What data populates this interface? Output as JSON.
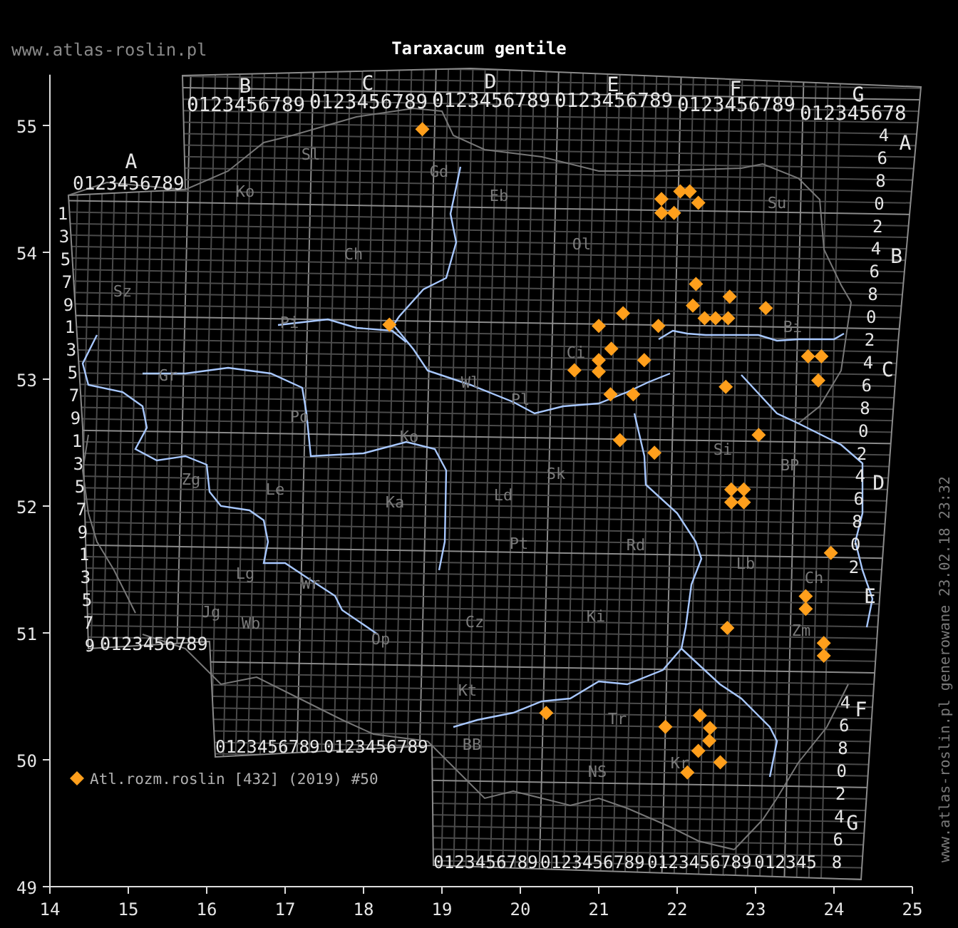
{
  "site": "www.atlas-roslin.pl",
  "title": "Taraxacum gentile",
  "stamp": "www.atlas-roslin.pl generowane 23.02.18 23:32",
  "grid": {
    "top_letters": [
      "B",
      "C",
      "D",
      "E",
      "F",
      "G"
    ],
    "top_digits": [
      "0123456789",
      "0123456789",
      "0123456789",
      "0123456789",
      "0123456789",
      "012345678"
    ],
    "a_letter": "A",
    "a_digits": "0123456789",
    "left_numbers": [
      "1",
      "3",
      "5",
      "7",
      "9",
      "1",
      "3",
      "5",
      "7",
      "9",
      "1",
      "3",
      "5",
      "7",
      "9",
      "1",
      "3",
      "5",
      "7",
      "9"
    ],
    "a_bottom_digits": "0123456789",
    "middle_bottom_digits": [
      "0123456789",
      "0123456789"
    ],
    "bottom_digits": [
      "0123456789",
      "0123456789",
      "0123456789",
      "012345"
    ],
    "right_numbers": [
      "4",
      "6",
      "8",
      "0",
      "2",
      "4",
      "6",
      "8",
      "0",
      "2",
      "4",
      "6",
      "8",
      "0",
      "2",
      "4",
      "6",
      "8",
      "0",
      "2"
    ],
    "right_numbers_lower": [
      "4",
      "6",
      "8",
      "0",
      "2",
      "4",
      "6",
      "8"
    ],
    "right_letters": [
      "A",
      "B",
      "C",
      "D",
      "E",
      "F",
      "G"
    ]
  },
  "region_labels": [
    "Sl",
    "Gd",
    "Ko",
    "Eb",
    "Su",
    "Ch",
    "Ol",
    "Sz",
    "Pi",
    "Bi",
    "Ci",
    "Gr",
    "Wl",
    "Pl",
    "Po",
    "Ko",
    "Si",
    "BP",
    "Zg",
    "Sk",
    "Le",
    "Ka",
    "Ld",
    "Pt",
    "Rd",
    "Lb",
    "Lg",
    "Wr",
    "Ch",
    "Jg",
    "Wb",
    "Cz",
    "Ki",
    "Op",
    "Zm",
    "Kt",
    "Tr",
    "BB",
    "NS",
    "Kr"
  ],
  "chart_data": {
    "type": "scatter",
    "xlim": [
      14,
      25
    ],
    "ylim": [
      49,
      55.4
    ],
    "xticks": [
      14,
      15,
      16,
      17,
      18,
      19,
      20,
      21,
      22,
      23,
      24,
      25
    ],
    "yticks": [
      49,
      50,
      51,
      52,
      53,
      54,
      55
    ],
    "x": [
      18.75,
      18.33,
      21.8,
      22.04,
      22.16,
      21.8,
      21.96,
      22.27,
      22.24,
      22.67,
      23.13,
      22.2,
      22.35,
      22.49,
      22.65,
      21.31,
      21.0,
      21.76,
      23.67,
      23.84,
      23.8,
      21.16,
      21.0,
      21.0,
      20.69,
      21.58,
      21.15,
      21.44,
      22.62,
      21.27,
      21.71,
      23.04,
      22.69,
      22.85,
      22.69,
      22.85,
      23.96,
      23.64,
      23.64,
      22.64,
      23.87,
      23.87,
      20.33,
      21.85,
      22.29,
      22.42,
      22.41,
      22.27,
      22.55,
      22.13
    ],
    "series": [
      {
        "name": "Atl.rozm.roslin [432] (2019) #50",
        "color": "#ff9f1c",
        "values": [
          54.97,
          53.43,
          54.42,
          54.48,
          54.48,
          54.31,
          54.31,
          54.39,
          53.75,
          53.65,
          53.56,
          53.58,
          53.48,
          53.48,
          53.48,
          53.52,
          53.42,
          53.42,
          53.18,
          53.18,
          52.99,
          53.24,
          53.15,
          53.06,
          53.07,
          53.15,
          52.88,
          52.88,
          52.94,
          52.52,
          52.42,
          52.56,
          52.13,
          52.13,
          52.03,
          52.03,
          51.63,
          51.29,
          51.19,
          51.04,
          50.92,
          50.82,
          50.37,
          50.26,
          50.35,
          50.25,
          50.15,
          50.07,
          49.98,
          49.9
        ]
      }
    ]
  }
}
